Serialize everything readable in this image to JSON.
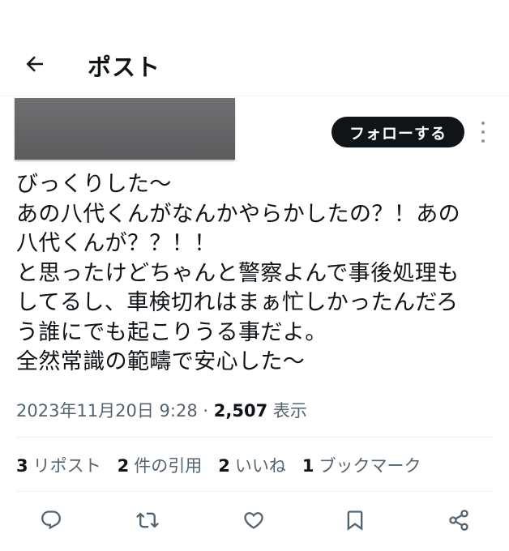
{
  "header": {
    "title": "ポスト",
    "back_icon": "arrow-left-icon"
  },
  "author": {
    "follow_label": "フォローする",
    "more_icon": "more-vertical-icon"
  },
  "tweet": {
    "lines": [
      "びっくりした〜",
      "あの八代くんがなんかやらかしたの？！あの",
      "八代くんが？？！！",
      "と思ったけどちゃんと警察よんで事後処理も",
      "してるし、車検切れはまぁ忙しかったんだろ",
      "う誰にでも起こりうる事だよ。",
      "全然常識の範疇で安心した〜"
    ]
  },
  "meta": {
    "datetime": "2023年11月20日 9:28",
    "separator": "·",
    "views": "2,507",
    "views_label": "表示"
  },
  "stats": {
    "reposts": {
      "count": "3",
      "label": "リポスト"
    },
    "quotes": {
      "count": "2",
      "label": "件の引用"
    },
    "likes": {
      "count": "2",
      "label": "いいね"
    },
    "bookmarks": {
      "count": "1",
      "label": "ブックマーク"
    }
  },
  "actions": [
    "reply-icon",
    "repost-icon",
    "like-icon",
    "bookmark-icon",
    "share-icon"
  ],
  "colors": {
    "text": "#0f1419",
    "secondary": "#536471",
    "divider": "#eff3f4",
    "follow_bg": "#0f1419"
  }
}
